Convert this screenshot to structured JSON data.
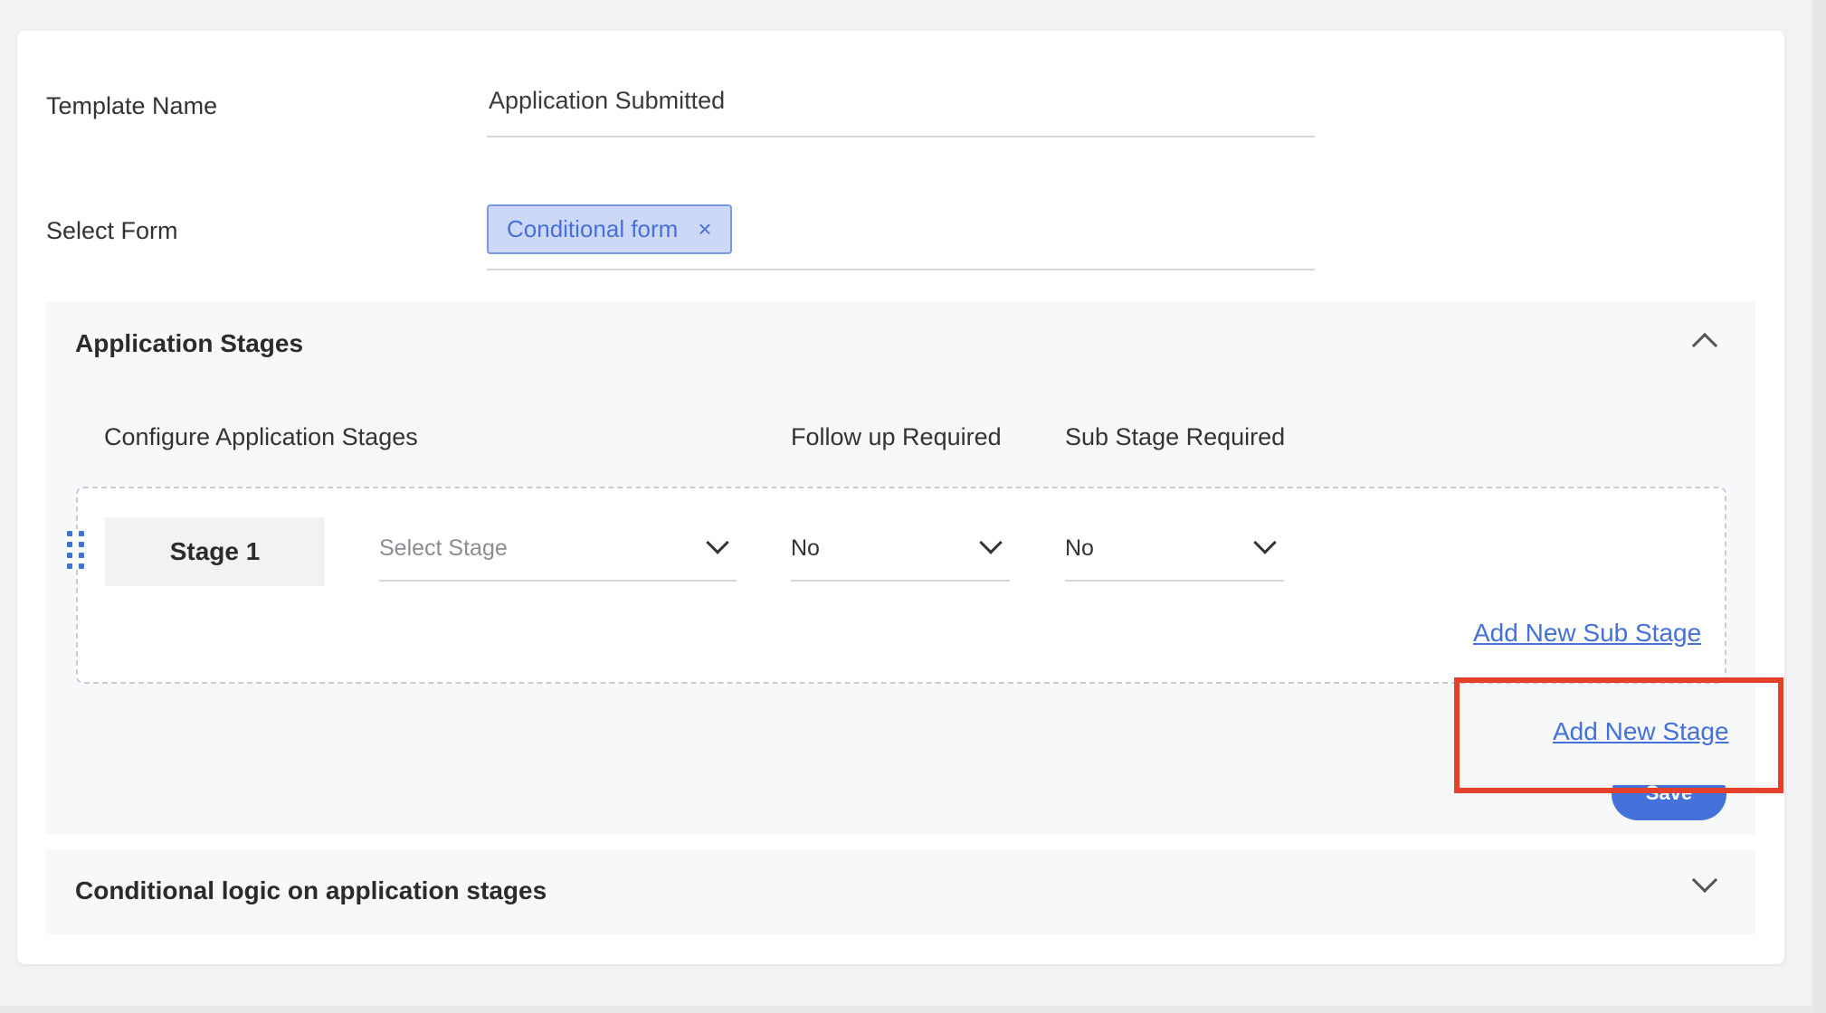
{
  "form": {
    "template_name_label": "Template Name",
    "template_name_value": "Application Submitted",
    "select_form_label": "Select Form",
    "selected_form_chip": "Conditional form",
    "chip_remove_glyph": "×"
  },
  "application_stages": {
    "title": "Application Stages",
    "expanded": true,
    "columns": {
      "configure": "Configure Application Stages",
      "follow_up": "Follow up Required",
      "sub_stage": "Sub Stage Required"
    },
    "stages": [
      {
        "label": "Stage 1",
        "stage_placeholder": "Select Stage",
        "follow_up_value": "No",
        "sub_stage_value": "No"
      }
    ],
    "add_sub_stage_link": "Add New Sub Stage",
    "add_stage_link": "Add New Stage",
    "save_button": "Save"
  },
  "conditional_logic": {
    "title": "Conditional logic on application stages",
    "expanded": false
  },
  "icons": {
    "drag": "drag-handle-icon",
    "collapse": "chevron-up-icon",
    "expand": "chevron-down-icon",
    "dropdown": "chevron-down-icon"
  },
  "colors": {
    "accent": "#4572da",
    "chip_bg": "#cdd8f6",
    "highlight": "#e5402c"
  }
}
